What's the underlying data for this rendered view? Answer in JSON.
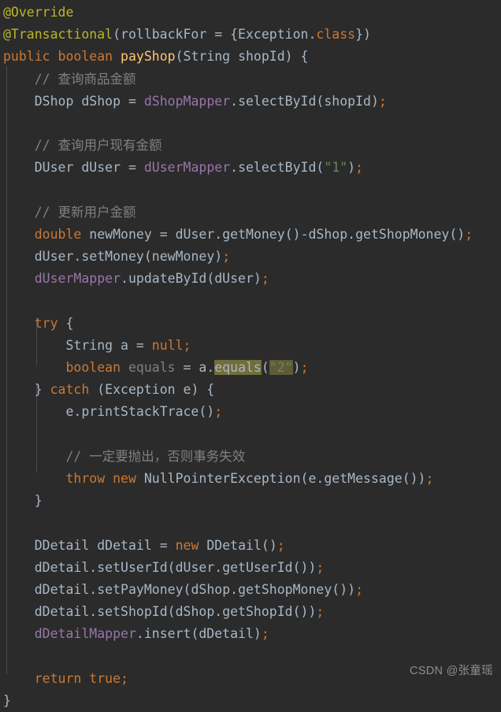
{
  "editor": {
    "background_color": "#2b2b2b",
    "default_text_color": "#a9b7c6",
    "language": "Java",
    "colors": {
      "annotation": "#bbb529",
      "keyword": "#cc7832",
      "method": "#ffc66d",
      "field": "#9876aa",
      "string": "#6a8759",
      "comment": "#808080",
      "identifier_highlight_bg": "#726e3a",
      "string_highlight_bg": "#5f5a38",
      "indent_guide": "#4b4b4b"
    }
  },
  "code": {
    "lines": [
      {
        "id": 1,
        "text": "@Override"
      },
      {
        "id": 2,
        "text": "@Transactional(rollbackFor = {Exception.class})"
      },
      {
        "id": 3,
        "text": "public boolean payShop(String shopId) {"
      },
      {
        "id": 4,
        "text": "    // 查询商品金额"
      },
      {
        "id": 5,
        "text": "    DShop dShop = dShopMapper.selectById(shopId);"
      },
      {
        "id": 6,
        "text": ""
      },
      {
        "id": 7,
        "text": "    // 查询用户现有金额"
      },
      {
        "id": 8,
        "text": "    DUser dUser = dUserMapper.selectById(\"1\");"
      },
      {
        "id": 9,
        "text": ""
      },
      {
        "id": 10,
        "text": "    // 更新用户金额"
      },
      {
        "id": 11,
        "text": "    double newMoney = dUser.getMoney()-dShop.getShopMoney();"
      },
      {
        "id": 12,
        "text": "    dUser.setMoney(newMoney);"
      },
      {
        "id": 13,
        "text": "    dUserMapper.updateById(dUser);"
      },
      {
        "id": 14,
        "text": ""
      },
      {
        "id": 15,
        "text": "    try {"
      },
      {
        "id": 16,
        "text": "        String a = null;"
      },
      {
        "id": 17,
        "text": "        boolean equals = a.equals(\"2\");"
      },
      {
        "id": 18,
        "text": "    } catch (Exception e) {"
      },
      {
        "id": 19,
        "text": "        e.printStackTrace();"
      },
      {
        "id": 20,
        "text": ""
      },
      {
        "id": 21,
        "text": "        // 一定要抛出，否则事务失效"
      },
      {
        "id": 22,
        "text": "        throw new NullPointerException(e.getMessage());"
      },
      {
        "id": 23,
        "text": "    }"
      },
      {
        "id": 24,
        "text": ""
      },
      {
        "id": 25,
        "text": "    DDetail dDetail = new DDetail();"
      },
      {
        "id": 26,
        "text": "    dDetail.setUserId(dUser.getUserId());"
      },
      {
        "id": 27,
        "text": "    dDetail.setPayMoney(dShop.getShopMoney());"
      },
      {
        "id": 28,
        "text": "    dDetail.setShopId(dShop.getShopId());"
      },
      {
        "id": 29,
        "text": "    dDetailMapper.insert(dDetail);"
      },
      {
        "id": 30,
        "text": ""
      },
      {
        "id": 31,
        "text": "    return true;"
      },
      {
        "id": 32,
        "text": "}"
      }
    ],
    "tokens": {
      "l1_annotation": "@Override",
      "l2_annotation": "@Transactional",
      "l2_open_paren": "(",
      "l2_attr": "rollbackFor",
      "l2_eq": " = ",
      "l2_brace_open": "{",
      "l2_exception": "Exception",
      "l2_dot": ".",
      "l2_class_kw": "class",
      "l2_brace_close": "}",
      "l2_close_paren": ")",
      "l3_public": "public",
      "l3_boolean": "boolean",
      "l3_method": "payShop",
      "l3_paren_open": "(",
      "l3_type_string": "String",
      "l3_param": "shopId",
      "l3_paren_close": ")",
      "l3_brace": "{",
      "l4_comment": "// 查询商品金额",
      "l5_type": "DShop",
      "l5_var": "dShop",
      "l5_eq": " = ",
      "l5_field": "dShopMapper",
      "l5_dot": ".",
      "l5_call": "selectById",
      "l5_arg": "shopId",
      "l7_comment": "// 查询用户现有金额",
      "l8_type": "DUser",
      "l8_var": "dUser",
      "l8_field": "dUserMapper",
      "l8_call": "selectById",
      "l8_string": "\"1\"",
      "l10_comment": "// 更新用户金额",
      "l11_double": "double",
      "l11_var": "newMoney",
      "l11_obj1": "dUser",
      "l11_call1": "getMoney",
      "l11_minus": "-",
      "l11_obj2": "dShop",
      "l11_call2": "getShopMoney",
      "l12_obj": "dUser",
      "l12_call": "setMoney",
      "l12_arg": "newMoney",
      "l13_field": "dUserMapper",
      "l13_call": "updateById",
      "l13_arg": "dUser",
      "l15_try": "try",
      "l16_type": "String",
      "l16_var": "a",
      "l16_null": "null",
      "l17_boolean": "boolean",
      "l17_var": "equals",
      "l17_obj": "a",
      "l17_call_highlighted": "equals",
      "l17_string_highlighted": "\"2\"",
      "l18_catch": "catch",
      "l18_type": "Exception",
      "l18_var": "e",
      "l19_obj": "e",
      "l19_call": "printStackTrace",
      "l21_comment": "// 一定要抛出，否则事务失效",
      "l22_throw": "throw",
      "l22_new": "new",
      "l22_type": "NullPointerException",
      "l22_obj": "e",
      "l22_call": "getMessage",
      "l25_type": "DDetail",
      "l25_var": "dDetail",
      "l25_new": "new",
      "l25_ctor": "DDetail",
      "l26_obj": "dDetail",
      "l26_call": "setUserId",
      "l26_obj2": "dUser",
      "l26_call2": "getUserId",
      "l27_obj": "dDetail",
      "l27_call": "setPayMoney",
      "l27_obj2": "dShop",
      "l27_call2": "getShopMoney",
      "l28_obj": "dDetail",
      "l28_call": "setShopId",
      "l28_obj2": "dShop",
      "l28_call2": "getShopId",
      "l29_field": "dDetailMapper",
      "l29_call": "insert",
      "l29_arg": "dDetail",
      "l31_return": "return",
      "l31_true": "true",
      "l32_brace": "}"
    }
  },
  "watermark": {
    "text": "CSDN @张童瑶"
  }
}
